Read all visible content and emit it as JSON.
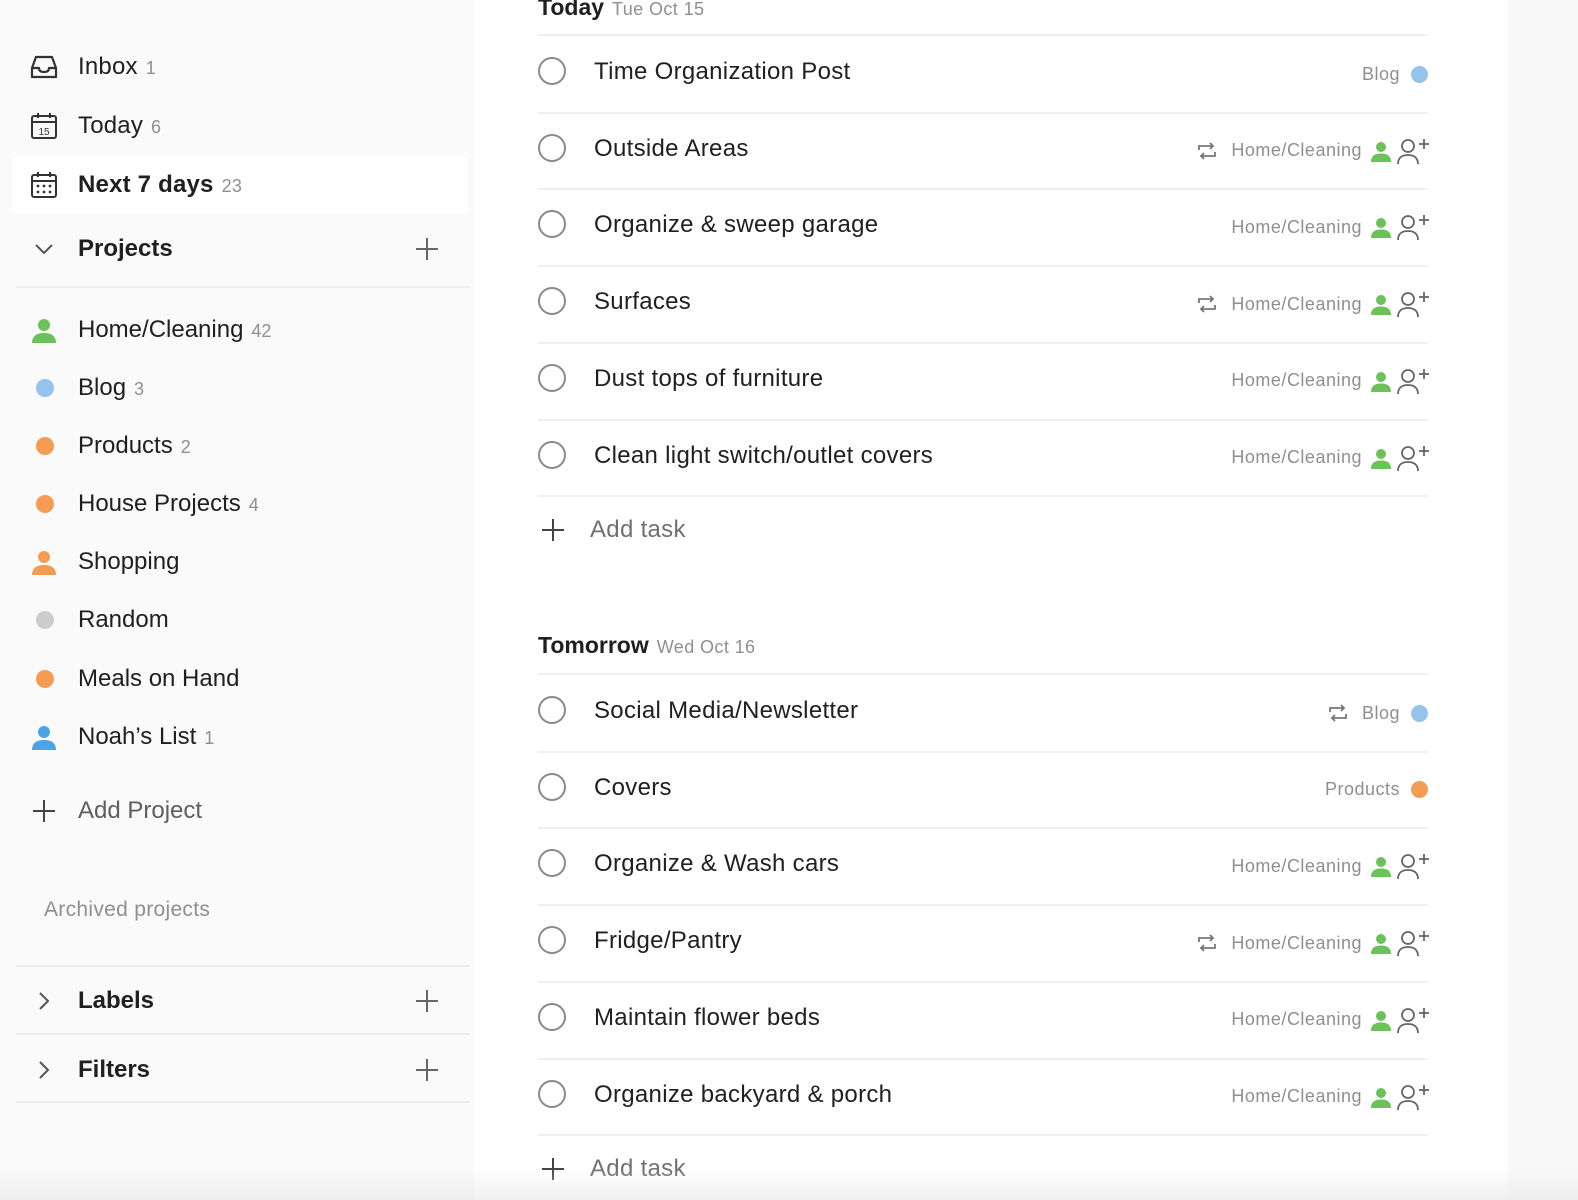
{
  "sidebar": {
    "nav": [
      {
        "label": "Inbox",
        "count": "1",
        "icon": "inbox-icon"
      },
      {
        "label": "Today",
        "count": "6",
        "icon": "calendar-today-icon",
        "day": "15"
      },
      {
        "label": "Next 7 days",
        "count": "23",
        "icon": "calendar-week-icon",
        "active": true
      }
    ],
    "projects_title": "Projects",
    "projects": [
      {
        "label": "Home/Cleaning",
        "count": "42",
        "icon": "person-icon",
        "color": "#6ac259"
      },
      {
        "label": "Blog",
        "count": "3",
        "icon": "dot-icon",
        "color": "#96c3eb"
      },
      {
        "label": "Products",
        "count": "2",
        "icon": "dot-icon",
        "color": "#f59c53"
      },
      {
        "label": "House Projects",
        "count": "4",
        "icon": "dot-icon",
        "color": "#f59c53"
      },
      {
        "label": "Shopping",
        "count": "",
        "icon": "person-icon",
        "color": "#f59c53"
      },
      {
        "label": "Random",
        "count": "",
        "icon": "dot-icon",
        "color": "#cccccc"
      },
      {
        "label": "Meals on Hand",
        "count": "",
        "icon": "dot-icon",
        "color": "#f59c53"
      },
      {
        "label": "Noah’s List",
        "count": "1",
        "icon": "person-icon",
        "color": "#4ba4e6"
      }
    ],
    "add_project": "Add Project",
    "archived": "Archived projects",
    "labels_title": "Labels",
    "filters_title": "Filters"
  },
  "sections": [
    {
      "title": "Today",
      "date": "Tue Oct 15",
      "tasks": [
        {
          "text": "Time Organization Post",
          "project": "Blog",
          "repeat": false,
          "shared": false,
          "color": "#96c3eb"
        },
        {
          "text": "Outside Areas",
          "project": "Home/Cleaning",
          "repeat": true,
          "shared": true,
          "color": "#6ac259"
        },
        {
          "text": "Organize & sweep garage",
          "project": "Home/Cleaning",
          "repeat": false,
          "shared": true,
          "color": "#6ac259"
        },
        {
          "text": "Surfaces",
          "project": "Home/Cleaning",
          "repeat": true,
          "shared": true,
          "color": "#6ac259"
        },
        {
          "text": "Dust tops of furniture",
          "project": "Home/Cleaning",
          "repeat": false,
          "shared": true,
          "color": "#6ac259"
        },
        {
          "text": "Clean light switch/outlet covers",
          "project": "Home/Cleaning",
          "repeat": false,
          "shared": true,
          "color": "#6ac259"
        }
      ],
      "add_task": "Add task"
    },
    {
      "title": "Tomorrow",
      "date": "Wed Oct 16",
      "tasks": [
        {
          "text": "Social Media/Newsletter",
          "project": "Blog",
          "repeat": true,
          "shared": false,
          "color": "#96c3eb"
        },
        {
          "text": "Covers",
          "project": "Products",
          "repeat": false,
          "shared": false,
          "color": "#f59c53"
        },
        {
          "text": "Organize & Wash cars",
          "project": "Home/Cleaning",
          "repeat": false,
          "shared": true,
          "color": "#6ac259"
        },
        {
          "text": "Fridge/Pantry",
          "project": "Home/Cleaning",
          "repeat": true,
          "shared": true,
          "color": "#6ac259"
        },
        {
          "text": "Maintain flower beds",
          "project": "Home/Cleaning",
          "repeat": false,
          "shared": true,
          "color": "#6ac259"
        },
        {
          "text": "Organize backyard & porch",
          "project": "Home/Cleaning",
          "repeat": false,
          "shared": true,
          "color": "#6ac259"
        }
      ],
      "add_task": "Add task"
    }
  ]
}
